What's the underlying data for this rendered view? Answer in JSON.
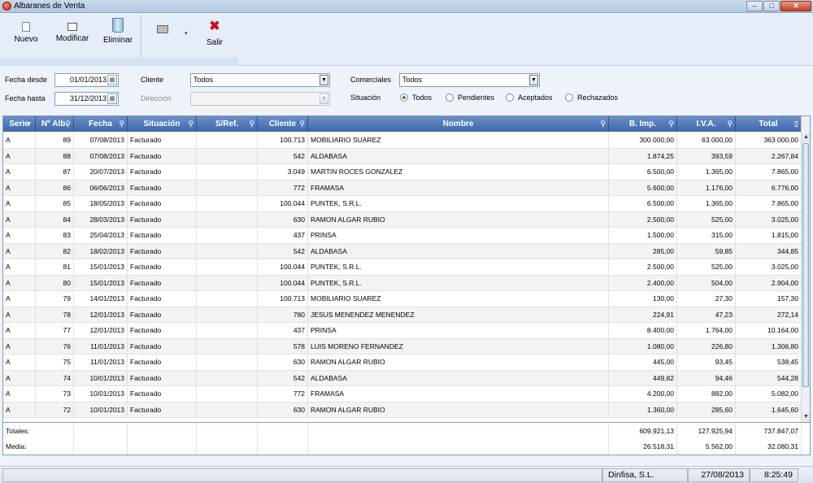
{
  "window": {
    "title": "Albaranes de Venta",
    "buttons": {
      "minimize": "–",
      "maximize": "□",
      "close": "✕"
    }
  },
  "toolbar": {
    "nuevo": "Nuevo",
    "modificar": "Modificar",
    "eliminar": "Eliminar",
    "salir": "Salir",
    "print_dropdown": "▾"
  },
  "filters": {
    "fecha_desde_label": "Fecha desde",
    "fecha_desde": "01/01/2013",
    "fecha_hasta_label": "Fecha hasta",
    "fecha_hasta": "31/12/2013",
    "cliente_label": "Cliente",
    "cliente_value": "Todos",
    "direccion_label": "Dirección",
    "direccion_value": "",
    "comerciales_label": "Comerciales",
    "comerciales_value": "Todos",
    "situacion_label": "Situación",
    "situacion_options": [
      "Todos",
      "Pendientes",
      "Aceptados",
      "Rechazados"
    ],
    "situacion_selected": "Todos"
  },
  "grid": {
    "columns": [
      "Serie",
      "Nº Alb.",
      "Fecha",
      "Situación",
      "S/Ref.",
      "Cliente",
      "Nombre",
      "B. Imp.",
      "I.V.A.",
      "Total"
    ],
    "rows": [
      [
        "A",
        "89",
        "07/08/2013",
        "Facturado",
        "",
        "100.713",
        "MOBILIARIO SUAREZ",
        "300.000,00",
        "63.000,00",
        "363.000,00"
      ],
      [
        "A",
        "88",
        "07/08/2013",
        "Facturado",
        "",
        "542",
        "ALDABASA",
        "1.874,25",
        "393,59",
        "2.267,84"
      ],
      [
        "A",
        "87",
        "20/07/2013",
        "Facturado",
        "",
        "3.049",
        "MARTIN ROCES GONZALEZ",
        "6.500,00",
        "1.365,00",
        "7.865,00"
      ],
      [
        "A",
        "86",
        "06/06/2013",
        "Facturado",
        "",
        "772",
        "FRAMASA",
        "5.600,00",
        "1.176,00",
        "6.776,00"
      ],
      [
        "A",
        "85",
        "18/05/2013",
        "Facturado",
        "",
        "100.044",
        "PUNTEK, S.R.L.",
        "6.500,00",
        "1.365,00",
        "7.865,00"
      ],
      [
        "A",
        "84",
        "28/03/2013",
        "Facturado",
        "",
        "630",
        "RAMON ALGAR RUBIO",
        "2.500,00",
        "525,00",
        "3.025,00"
      ],
      [
        "A",
        "83",
        "25/04/2013",
        "Facturado",
        "",
        "437",
        "PRINSA",
        "1.500,00",
        "315,00",
        "1.815,00"
      ],
      [
        "A",
        "82",
        "18/02/2013",
        "Facturado",
        "",
        "542",
        "ALDABASA",
        "285,00",
        "59,85",
        "344,85"
      ],
      [
        "A",
        "81",
        "15/01/2013",
        "Facturado",
        "",
        "100.044",
        "PUNTEK, S.R.L.",
        "2.500,00",
        "525,00",
        "3.025,00"
      ],
      [
        "A",
        "80",
        "15/01/2013",
        "Facturado",
        "",
        "100.044",
        "PUNTEK, S.R.L.",
        "2.400,00",
        "504,00",
        "2.904,00"
      ],
      [
        "A",
        "79",
        "14/01/2013",
        "Facturado",
        "",
        "100.713",
        "MOBILIARIO SUAREZ",
        "130,00",
        "27,30",
        "157,30"
      ],
      [
        "A",
        "78",
        "12/01/2013",
        "Facturado",
        "",
        "780",
        "JESUS MENENDEZ MENENDEZ",
        "224,91",
        "47,23",
        "272,14"
      ],
      [
        "A",
        "77",
        "12/01/2013",
        "Facturado",
        "",
        "437",
        "PRINSA",
        "8.400,00",
        "1.764,00",
        "10.164,00"
      ],
      [
        "A",
        "76",
        "11/01/2013",
        "Facturado",
        "",
        "578",
        "LUIS MORENO FERNANDEZ",
        "1.080,00",
        "226,80",
        "1.306,80"
      ],
      [
        "A",
        "75",
        "11/01/2013",
        "Facturado",
        "",
        "630",
        "RAMON ALGAR RUBIO",
        "445,00",
        "93,45",
        "538,45"
      ],
      [
        "A",
        "74",
        "10/01/2013",
        "Facturado",
        "",
        "542",
        "ALDABASA",
        "449,82",
        "94,46",
        "544,28"
      ],
      [
        "A",
        "73",
        "10/01/2013",
        "Facturado",
        "",
        "772",
        "FRAMASA",
        "4.200,00",
        "882,00",
        "5.082,00"
      ],
      [
        "A",
        "72",
        "10/01/2013",
        "Facturado",
        "",
        "630",
        "RAMON ALGAR RUBIO",
        "1.360,00",
        "285,60",
        "1.645,60"
      ]
    ]
  },
  "footer": {
    "totales_label": "Totales:",
    "media_label": "Media:",
    "totales": {
      "b_imp": "609.921,13",
      "iva": "127.925,94",
      "total": "737.847,07"
    },
    "media": {
      "b_imp": "26.518,31",
      "iva": "5.562,00",
      "total": "32.080,31"
    }
  },
  "status": {
    "company": "Dinfisa, S.L.",
    "date": "27/08/2013",
    "time": "8:25:49"
  }
}
